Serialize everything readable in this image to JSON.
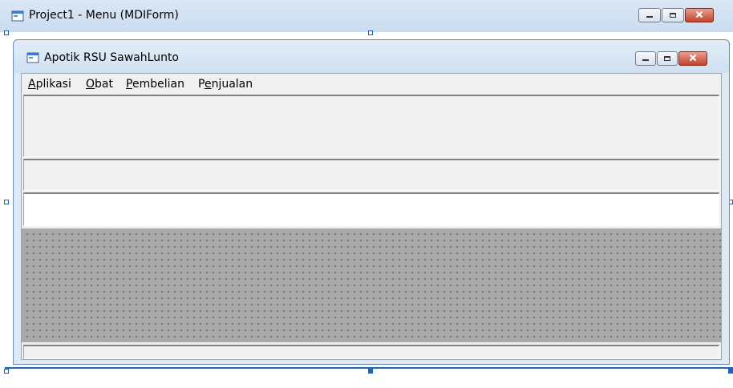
{
  "outer_window": {
    "title": "Project1 - Menu (MDIForm)"
  },
  "inner_window": {
    "title": "Apotik RSU  SawahLunto",
    "menu": [
      {
        "label": "Aplikasi",
        "underline_index": 0
      },
      {
        "label": "Obat",
        "underline_index": 0
      },
      {
        "label": "Pembelian",
        "underline_index": 0
      },
      {
        "label": "Penjualan",
        "underline_index": 1
      }
    ]
  },
  "icons": {
    "window_icon": "form-window-icon",
    "minimize": "minimize-icon",
    "maximize": "maximize-icon",
    "close": "close-icon"
  },
  "colors": {
    "selection_handle": "#1e63c8",
    "close_button": "#c4422a",
    "mdi_background": "#a9a9a9"
  }
}
